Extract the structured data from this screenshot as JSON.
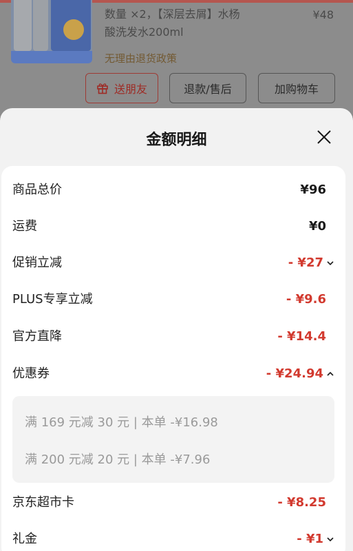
{
  "background_page": {
    "product_info_line1": "数量 ×2，【深层去屑】水杨",
    "product_info_line2": "酸洗发水200ml",
    "product_price": "¥48",
    "return_policy": "无理由退货政策",
    "buttons": {
      "gift": "送朋友",
      "refund": "退款/售后",
      "add_cart": "加购物车"
    }
  },
  "sheet": {
    "title": "金额明细",
    "rows": [
      {
        "label": "商品总价",
        "value": "¥96"
      },
      {
        "label": "运费",
        "value": "¥0"
      },
      {
        "label": "促销立减",
        "value": "- ¥27"
      },
      {
        "label": "PLUS专享立减",
        "value": "- ¥9.6"
      },
      {
        "label": "官方直降",
        "value": "- ¥14.4"
      },
      {
        "label": "优惠券",
        "value": "- ¥24.94"
      },
      {
        "label": "京东超市卡",
        "value": "- ¥8.25"
      },
      {
        "label": "礼金",
        "value": "- ¥1"
      }
    ],
    "coupons": [
      "满 169 元减 30 元 | 本单 -¥16.98",
      "满 200 元减 20 元 | 本单 -¥7.96"
    ]
  },
  "colors": {
    "discount_red": "#d23a2f",
    "sheet_bg": "#f2f2f2",
    "card_bg": "#ffffff"
  }
}
